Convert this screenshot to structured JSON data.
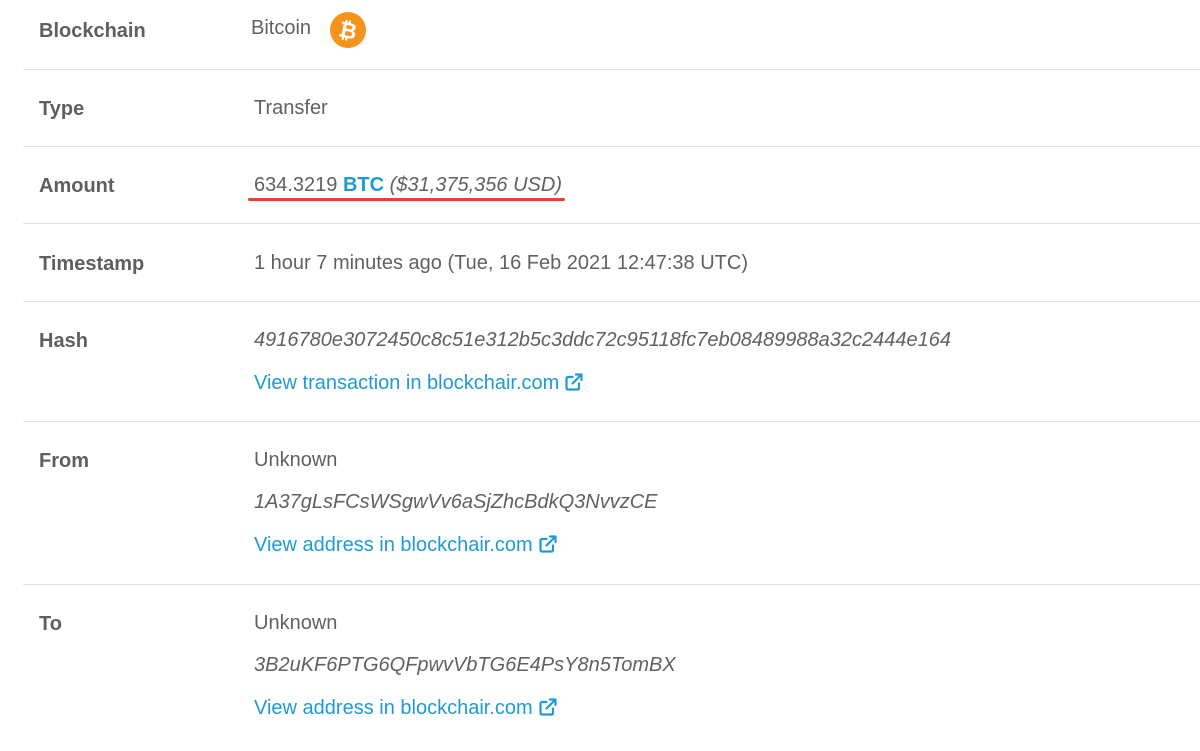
{
  "colors": {
    "label": "#5f5f5f",
    "value": "#616161",
    "link": "#1e9ad6",
    "divider": "#e3e3e3",
    "highlight_underline": "#e8432f",
    "bitcoin_badge": "#f7931a"
  },
  "rows": {
    "blockchain": {
      "label": "Blockchain",
      "value": "Bitcoin",
      "icon": "bitcoin-icon"
    },
    "type": {
      "label": "Type",
      "value": "Transfer"
    },
    "amount": {
      "label": "Amount",
      "quantity": "634.3219",
      "ticker": "BTC",
      "usd": "($31,375,356 USD)"
    },
    "timestamp": {
      "label": "Timestamp",
      "value": "1 hour 7 minutes ago (Tue, 16 Feb 2021 12:47:38 UTC)"
    },
    "hash": {
      "label": "Hash",
      "value": "4916780e3072450c8c51e312b5c3ddc72c95118fc7eb08489988a32c2444e164",
      "link_label": "View transaction in blockchair.com",
      "link_icon": "external-link-icon"
    },
    "from": {
      "label": "From",
      "owner": "Unknown",
      "address": "1A37gLsFCsWSgwVv6aSjZhcBdkQ3NvvzCE",
      "link_label": "View address in blockchair.com",
      "link_icon": "external-link-icon"
    },
    "to": {
      "label": "To",
      "owner": "Unknown",
      "address": "3B2uKF6PTG6QFpwvVbTG6E4PsY8n5TomBX",
      "link_label": "View address in blockchair.com",
      "link_icon": "external-link-icon"
    }
  }
}
